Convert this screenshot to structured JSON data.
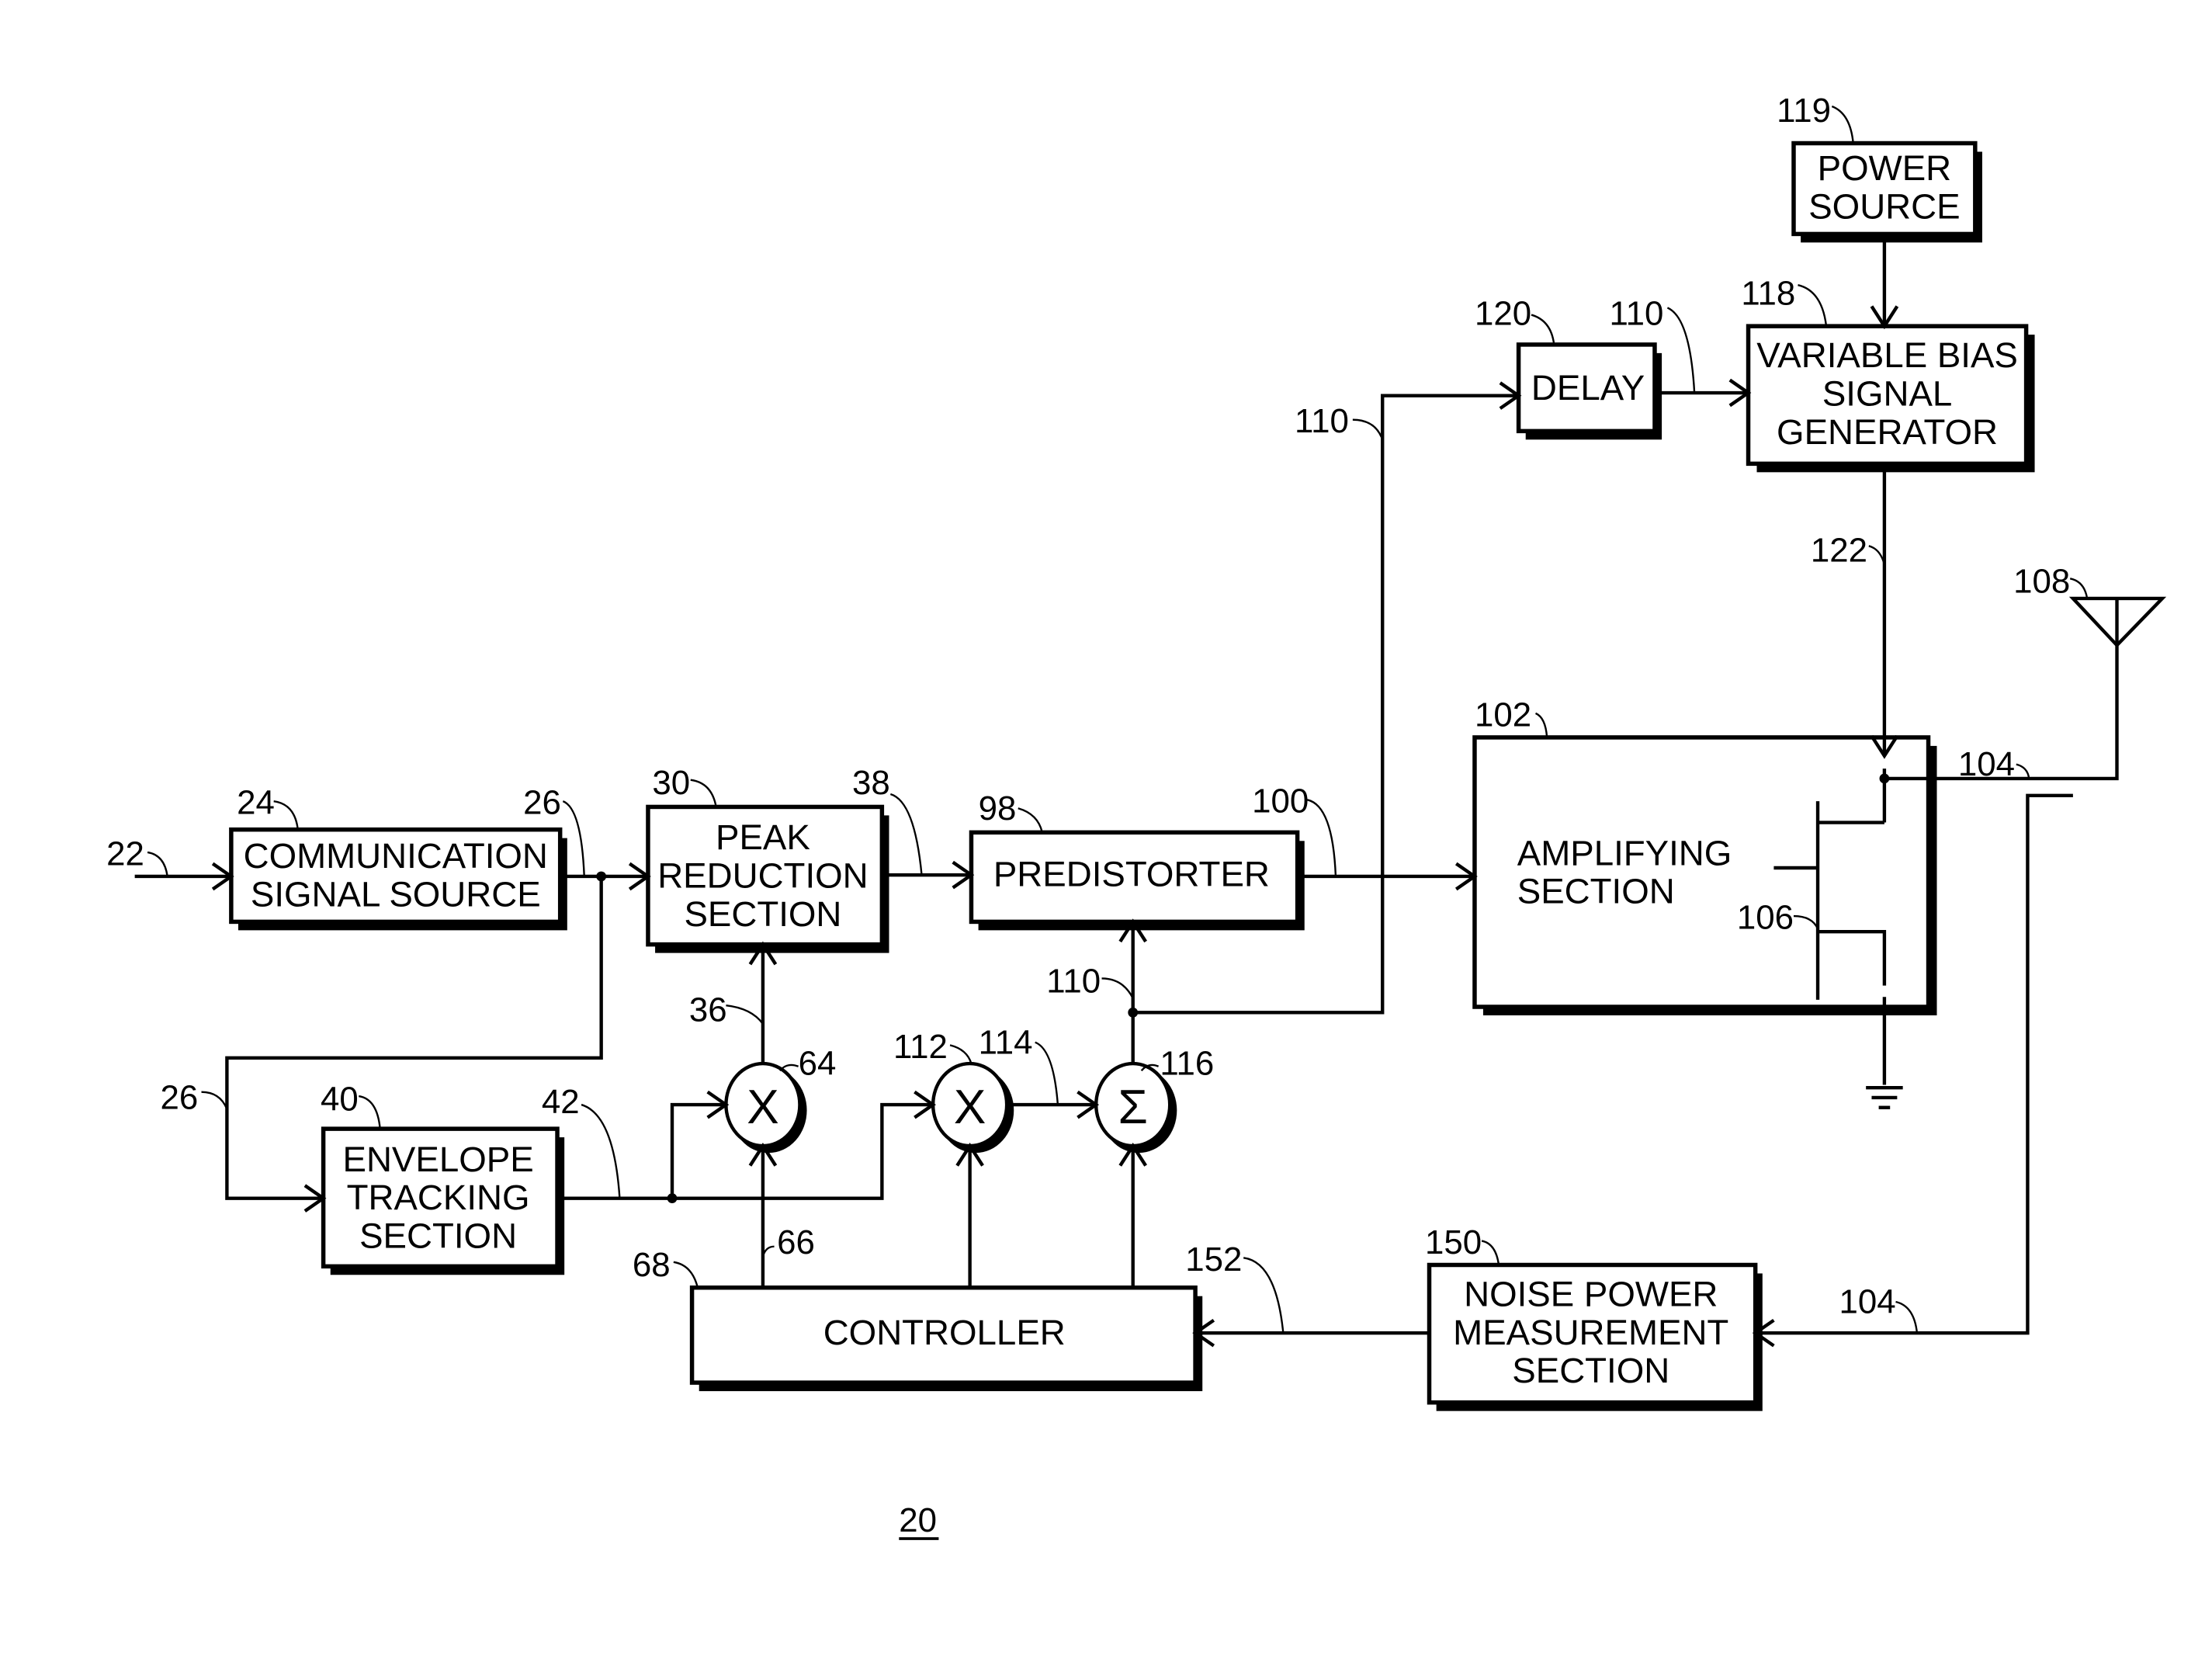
{
  "figure": {
    "number_label": "20"
  },
  "blocks": {
    "communication_signal_source": {
      "lines": [
        "COMMUNICATION",
        "SIGNAL SOURCE"
      ],
      "ref": "24"
    },
    "peak_reduction_section": {
      "lines": [
        "PEAK",
        "REDUCTION",
        "SECTION"
      ],
      "ref": "30"
    },
    "predistorter": {
      "lines": [
        "PREDISTORTER"
      ],
      "ref": "98"
    },
    "envelope_tracking_section": {
      "lines": [
        "ENVELOPE",
        "TRACKING",
        "SECTION"
      ],
      "ref": "40"
    },
    "controller": {
      "lines": [
        "CONTROLLER"
      ],
      "ref": "68"
    },
    "noise_power_measurement_section": {
      "lines": [
        "NOISE POWER",
        "MEASUREMENT",
        "SECTION"
      ],
      "ref": "150"
    },
    "amplifying_section": {
      "lines": [
        "AMPLIFYING",
        "SECTION"
      ],
      "ref": "102"
    },
    "delay": {
      "lines": [
        "DELAY"
      ],
      "ref": "120"
    },
    "variable_bias_signal_generator": {
      "lines": [
        "VARIABLE BIAS",
        "SIGNAL",
        "GENERATOR"
      ],
      "ref": "118"
    },
    "power_source": {
      "lines": [
        "POWER",
        "SOURCE"
      ],
      "ref": "119"
    }
  },
  "operators": {
    "multiplier_64": {
      "symbol": "X",
      "ref": "64"
    },
    "multiplier_112": {
      "symbol": "X",
      "ref": "112"
    },
    "summer_116": {
      "symbol": "Σ",
      "ref": "116"
    }
  },
  "signal_refs": {
    "input": "22",
    "comm_signal_top": "26",
    "comm_signal_left": "26",
    "peak_out": "38",
    "envelope_out": "42",
    "scale_36": "36",
    "ctrl_66": "66",
    "product_114": "114",
    "bias_110_mid": "110",
    "bias_110_left": "110",
    "bias_110_delay": "110",
    "predistorted_100": "100",
    "bias_122": "122",
    "rf_out_104_top": "104",
    "rf_out_104_bottom": "104",
    "transistor_106": "106",
    "antenna_108": "108",
    "noise_152": "152"
  }
}
